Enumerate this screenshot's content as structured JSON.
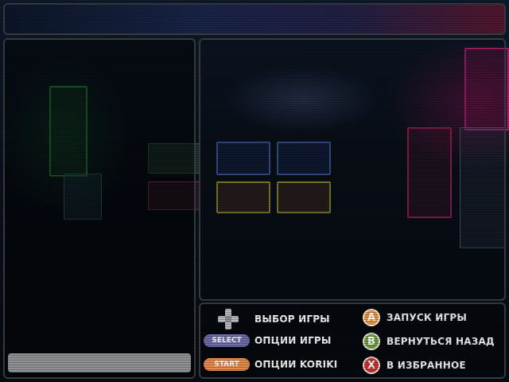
{
  "colors": {
    "select_pill": "#6e6aa8",
    "start_pill": "#e58a4a",
    "button_a": "#e8913a",
    "button_b": "#6a9a3a",
    "button_x": "#c8302a",
    "frame": "#3a3d40"
  },
  "controls": {
    "dpad": {
      "icon": "dpad-icon",
      "label": "ВЫБОР ИГРЫ"
    },
    "select": {
      "button": "SELECT",
      "label": "ОПЦИИ ИГРЫ"
    },
    "start": {
      "button": "START",
      "label": "ОПЦИИ KORIKI"
    },
    "a": {
      "button": "A",
      "label": "ЗАПУСК ИГРЫ"
    },
    "b": {
      "button": "B",
      "label": "ВЕРНУТЬСЯ НАЗАД"
    },
    "x": {
      "button": "X",
      "label": "В ИЗБРАННОЕ"
    }
  }
}
